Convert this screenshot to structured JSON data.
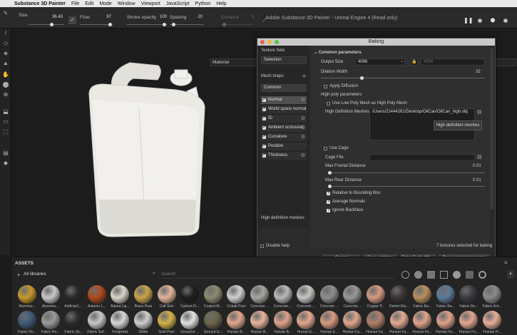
{
  "menubar": {
    "app_name": "Substance 3D Painter",
    "items": [
      "File",
      "Edit",
      "Mode",
      "Window",
      "Viewport",
      "JavaScript",
      "Python",
      "Help"
    ]
  },
  "window_title": "Adobe Substance 3D Painter - Unreal Engine 4 (Read only)",
  "toolbar": {
    "size_label": "Size",
    "size_value": "36.43",
    "flow_label": "Flow",
    "flow_value": "97",
    "stroke_label": "Stroke opacity",
    "stroke_value": "100",
    "spacing_label": "Spacing",
    "spacing_value": "20",
    "distance_label": "Distance",
    "distance_value": "5"
  },
  "viewport": {
    "material_dropdown_left": "Material",
    "material_dropdown_right": "Material"
  },
  "baking": {
    "title": "Baking",
    "texture_sets_label": "Texture Sets",
    "selection_label": "Selection",
    "mesh_maps_label": "Mesh maps:",
    "common_label": "Common",
    "mesh_maps": [
      "Normal",
      "World space normal",
      "ID",
      "Ambient occlusion",
      "Curvature",
      "Position",
      "Thickness"
    ],
    "section_title": "Common parameters",
    "output_size_label": "Output Size",
    "output_size_value": "4096",
    "output_size_linked": "4096",
    "dilation_label": "Dilation Width",
    "dilation_value": "32",
    "apply_diffusion_label": "Apply Diffusion",
    "high_poly_params_label": "High poly parameters",
    "use_low_poly_label": "Use Low Poly Mesh as High Poly Mesh",
    "hd_meshes_label": "High Definition Meshes",
    "hd_mesh_path": "/Users/21444261/Desktop/OilCan/OilCan_high.obj",
    "hd_tooltip": "High definition meshes",
    "use_cage_label": "Use Cage",
    "cage_file_label": "Cage File",
    "max_frontal_label": "Max Frontal Distance",
    "max_frontal_value": "0.01",
    "max_rear_label": "Max Rear Distance",
    "max_rear_value": "0.01",
    "relative_bbox_label": "Relative to Bounding Box",
    "average_normals_label": "Average Normals",
    "ignore_backface_label": "Ignore Backface",
    "help_text": "High definition meshes",
    "disable_help_label": "Disable help",
    "status_text": "7 textures selected for baking",
    "cancel_label": "Cancel",
    "save_settings_label": "Save settings",
    "bake_default_label": "Bake DefaultM...",
    "bake_selected_label": "Bake selected textures"
  },
  "assets": {
    "title": "ASSETS",
    "all_libraries_label": "All libraries",
    "search_placeholder": "Search",
    "row1": [
      {
        "label": "Aluminiu...",
        "color": "#c6982e"
      },
      {
        "label": "Aluminiu...",
        "color": "#c8c8c8"
      },
      {
        "label": "Artificial L...",
        "color": "#2a2a2a"
      },
      {
        "label": "Autumn L...",
        "color": "#b04a1e"
      },
      {
        "label": "Baked Lig...",
        "color": "#d9d4c8"
      },
      {
        "label": "Brass Pure",
        "color": "#c9a44a"
      },
      {
        "label": "Calf Skin",
        "color": "#e0b49a"
      },
      {
        "label": "Carbon Fi...",
        "color": "#1e1e1e"
      },
      {
        "label": "Coated M...",
        "color": "#8e8a70"
      },
      {
        "label": "Cobalt Pure",
        "color": "#d0d0d0"
      },
      {
        "label": "Concrete ...",
        "color": "#a8a5a0"
      },
      {
        "label": "Concrete ...",
        "color": "#b8b8b8"
      },
      {
        "label": "Concrete ...",
        "color": "#c8c6c2"
      },
      {
        "label": "Concrete ...",
        "color": "#8f8f8f"
      },
      {
        "label": "Concrete ...",
        "color": "#9a9896"
      },
      {
        "label": "Copper P...",
        "color": "#d49a80"
      },
      {
        "label": "Denim Riv...",
        "color": "#3a3434"
      },
      {
        "label": "Fabric Ba...",
        "color": "#b98e60"
      },
      {
        "label": "Fabric Ba...",
        "color": "#5b7a96"
      },
      {
        "label": "Fabric De...",
        "color": "#3a3c40"
      },
      {
        "label": "Fabric Kni...",
        "color": "#8a8a8a"
      }
    ],
    "row2": [
      {
        "label": "Fabric Ro...",
        "color": "#3d5a78"
      },
      {
        "label": "Fabric Ro...",
        "color": "#9a9a9a"
      },
      {
        "label": "Fabric So...",
        "color": "#2c2c2c"
      },
      {
        "label": "Fabric Suf...",
        "color": "#c8c8c8"
      },
      {
        "label": "Footprints",
        "color": "#d8d8d8"
      },
      {
        "label": "Glitter",
        "color": "#cfcfcf"
      },
      {
        "label": "Gold Pure",
        "color": "#d4b24a"
      },
      {
        "label": "Gouache ...",
        "color": "#e2e2e2"
      },
      {
        "label": "Ground G...",
        "color": "#6a6448"
      },
      {
        "label": "Human B...",
        "color": "#e2a88e"
      },
      {
        "label": "Human B...",
        "color": "#e6b49c"
      },
      {
        "label": "Human B...",
        "color": "#dea28a"
      },
      {
        "label": "Human E...",
        "color": "#e2a890"
      },
      {
        "label": "Human E...",
        "color": "#d89a80"
      },
      {
        "label": "Human Fa...",
        "color": "#e0a68e"
      },
      {
        "label": "Human Fa...",
        "color": "#b0806a"
      },
      {
        "label": "Human Fa...",
        "color": "#e4aa92"
      },
      {
        "label": "Human Fe...",
        "color": "#e0a48c"
      },
      {
        "label": "Human Fo...",
        "color": "#dea28a"
      },
      {
        "label": "Human Fo...",
        "color": "#e2a690"
      },
      {
        "label": "Human H...",
        "color": "#e6ae96"
      }
    ]
  }
}
